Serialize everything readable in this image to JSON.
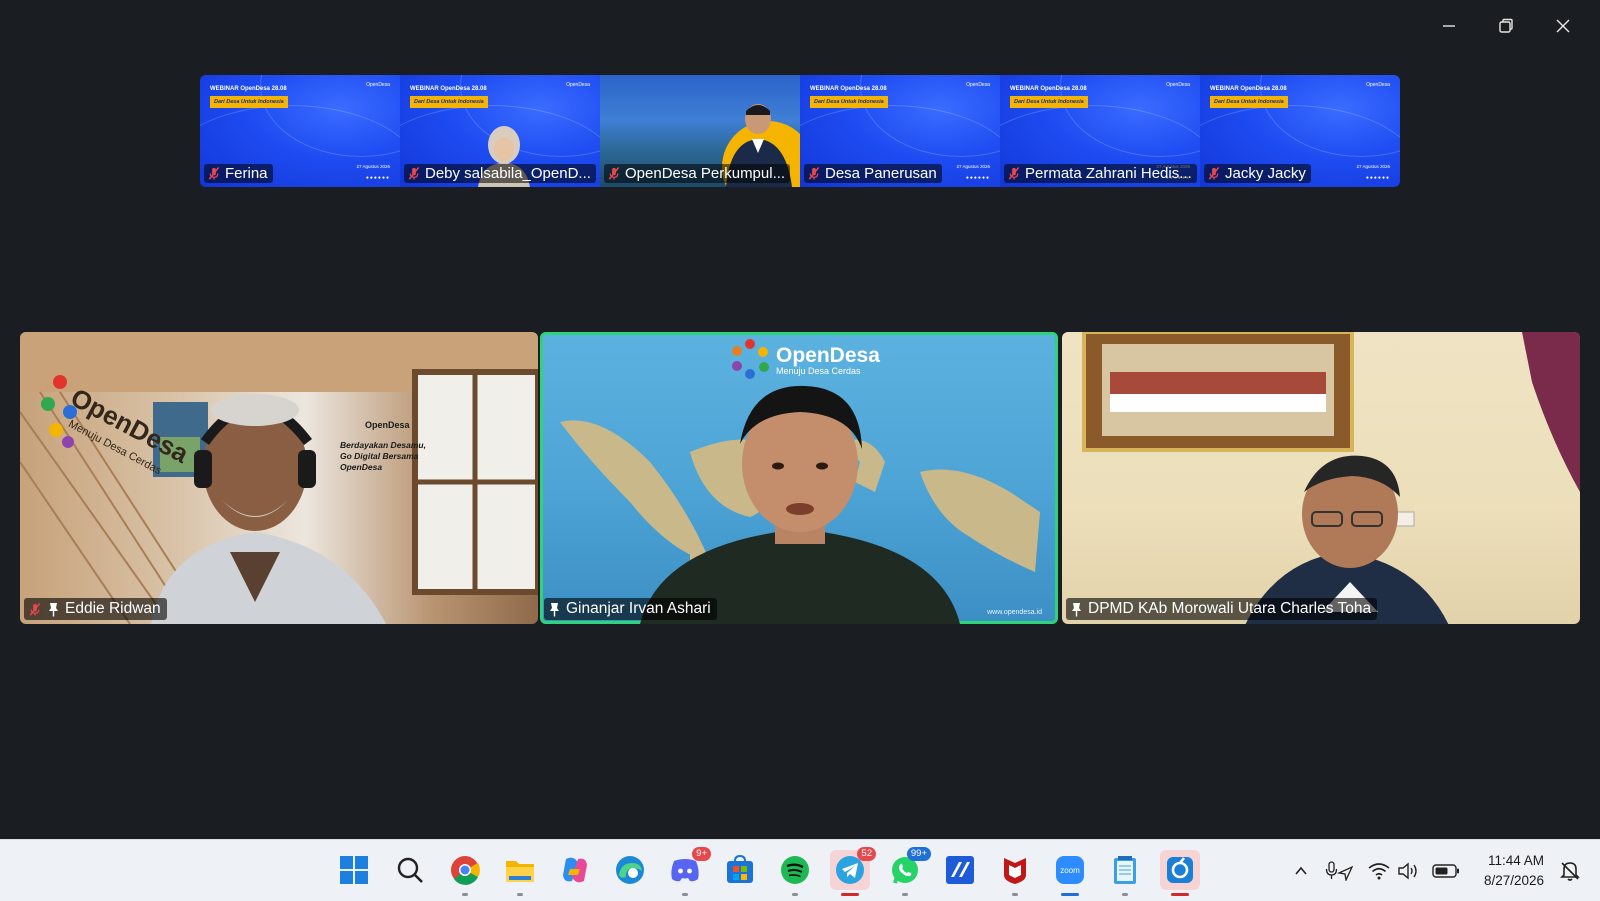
{
  "window": {
    "minimize_icon": "minimize-icon",
    "restore_icon": "restore-icon",
    "close_icon": "close-icon"
  },
  "webinar_slide": {
    "title": "WEBINAR OpenDesa 28.08",
    "tagline": "Dari Desa Untuk Indonesia",
    "logo": "OpenDesa",
    "date": "27 Agustus 2026"
  },
  "thumbnails": [
    {
      "name": "Ferina",
      "muted": true
    },
    {
      "name": "Deby salsabila_OpenD...",
      "muted": true
    },
    {
      "name": "OpenDesa Perkumpul...",
      "muted": true
    },
    {
      "name": "Desa Panerusan",
      "muted": true
    },
    {
      "name": "Permata Zahrani Hedis...",
      "muted": true
    },
    {
      "name": "Jacky Jacky",
      "muted": true
    }
  ],
  "main_videos": [
    {
      "name": "Eddie Ridwan",
      "muted": true,
      "pinned": true,
      "bg_text": [
        "Berdayakan Desamu,",
        "Go Digital Bersama",
        "OpenDesa"
      ],
      "brand": "OpenDesa",
      "brand_sub": "Menuju Desa Cerdas"
    },
    {
      "name": "Ginanjar Irvan Ashari",
      "muted": false,
      "pinned": true,
      "speaking": true,
      "brand": "OpenDesa",
      "brand_sub": "Menuju Desa Cerdas",
      "url": "www.opendesa.id"
    },
    {
      "name": "DPMD KAb Morowali Utara Charles Toha",
      "muted": false,
      "pinned": true
    }
  ],
  "taskbar": {
    "apps": [
      {
        "name": "windows-start-icon"
      },
      {
        "name": "search-icon"
      },
      {
        "name": "chrome-icon",
        "indicator": true
      },
      {
        "name": "file-explorer-icon",
        "indicator": true
      },
      {
        "name": "copilot-icon"
      },
      {
        "name": "edge-icon"
      },
      {
        "name": "discord-icon",
        "badge": "9+",
        "indicator": true
      },
      {
        "name": "microsoft-store-icon"
      },
      {
        "name": "spotify-icon",
        "indicator": true
      },
      {
        "name": "telegram-icon",
        "badge": "52",
        "active": true
      },
      {
        "name": "whatsapp-icon",
        "badge": "99+",
        "indicator": true
      },
      {
        "name": "jetbrains-icon"
      },
      {
        "name": "mcafee-icon",
        "indicator": true
      },
      {
        "name": "zoom-icon",
        "label": "zoom",
        "indicator": true
      },
      {
        "name": "notepad-icon",
        "indicator": true
      },
      {
        "name": "snipping-tool-icon",
        "active": true
      }
    ],
    "tray": {
      "chevron_icon": "chevron-up-icon",
      "mic_icon": "microphone-location-icon",
      "wifi_icon": "wifi-icon",
      "volume_icon": "volume-icon",
      "battery_icon": "battery-icon",
      "time": "11:44 AM",
      "date": "8/27/2026",
      "notification_icon": "notification-bell-icon"
    }
  },
  "colors": {
    "background": "#1a1d21",
    "active_speaker_border": "#2fd37a",
    "slide_blue": "#1e4cf2",
    "slide_yellow": "#f5b400"
  }
}
